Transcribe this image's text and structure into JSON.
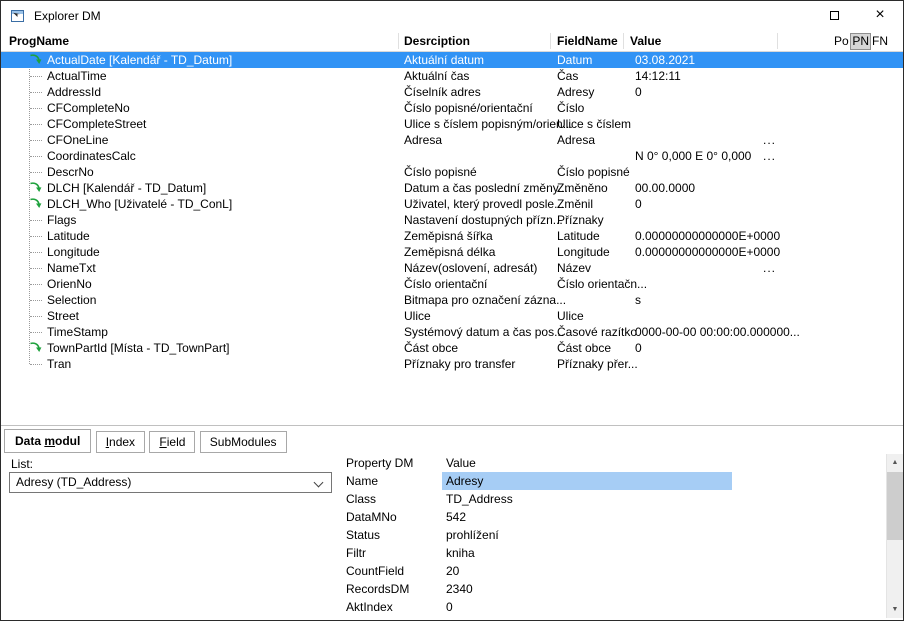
{
  "window": {
    "title": "Explorer DM",
    "close_glyph": "×"
  },
  "columns": {
    "progname": "ProgName",
    "description": "Desrciption",
    "fieldname": "FieldName",
    "value": "Value"
  },
  "filter_buttons": [
    {
      "label": "Po",
      "active": false
    },
    {
      "label": "PN",
      "active": true
    },
    {
      "label": "FN",
      "active": false
    }
  ],
  "tree": {
    "rows": [
      {
        "prog": "ActualDate [Kalendář - TD_Datum]",
        "desc": "Aktuální datum",
        "field": "Datum",
        "value": "03.08.2021",
        "icon": true,
        "selected": true
      },
      {
        "prog": "ActualTime",
        "desc": "Aktuální čas",
        "field": "Čas",
        "value": "14:12:11"
      },
      {
        "prog": "AddressId",
        "desc": "Číselník adres",
        "field": "Adresy",
        "value": "0"
      },
      {
        "prog": "CFCompleteNo",
        "desc": "Číslo popisné/orientační",
        "field": "Číslo",
        "value": ""
      },
      {
        "prog": "CFCompleteStreet",
        "desc": "Ulice s číslem popisným/orien...",
        "field": "Ulice s číslem",
        "value": ""
      },
      {
        "prog": "CFOneLine",
        "desc": "Adresa",
        "field": "Adresa",
        "value": "",
        "ellipsis": true
      },
      {
        "prog": "CoordinatesCalc",
        "desc": "",
        "field": "",
        "value": "N 0° 0,000 E 0° 0,000",
        "ellipsis": true
      },
      {
        "prog": "DescrNo",
        "desc": "Číslo popisné",
        "field": "Číslo popisné",
        "value": ""
      },
      {
        "prog": "DLCH [Kalendář - TD_Datum]",
        "desc": "Datum a čas poslední změny...",
        "field": "Změněno",
        "value": "00.00.0000",
        "icon": true
      },
      {
        "prog": "DLCH_Who [Uživatelé - TD_ConL]",
        "desc": "Uživatel, který provedl posle...",
        "field": "Změnil",
        "value": "0",
        "icon": true
      },
      {
        "prog": "Flags",
        "desc": "Nastavení dostupných přízn...",
        "field": "Příznaky",
        "value": ""
      },
      {
        "prog": "Latitude",
        "desc": "Zeměpisná šířka",
        "field": "Latitude",
        "value": "0.00000000000000E+0000"
      },
      {
        "prog": "Longitude",
        "desc": "Zeměpisná délka",
        "field": "Longitude",
        "value": "0.00000000000000E+0000"
      },
      {
        "prog": "NameTxt",
        "desc": "Název(oslovení, adresát)",
        "field": "Název",
        "value": "",
        "ellipsis": true
      },
      {
        "prog": "OrienNo",
        "desc": "Číslo orientační",
        "field": "Číslo orientačn...",
        "value": ""
      },
      {
        "prog": "Selection",
        "desc": "Bitmapa pro označení zázna...",
        "field": "",
        "value": "s"
      },
      {
        "prog": "Street",
        "desc": "Ulice",
        "field": "Ulice",
        "value": ""
      },
      {
        "prog": "TimeStamp",
        "desc": "Systémový datum a čas pos...",
        "field": "Časové razítko",
        "value": "0000-00-00 00:00:00.000000..."
      },
      {
        "prog": "TownPartId [Místa - TD_TownPart]",
        "desc": "Část obce",
        "field": "Část obce",
        "value": "0",
        "icon": true
      },
      {
        "prog": "Tran",
        "desc": "Příznaky pro transfer",
        "field": "Příznaky přer...",
        "value": ""
      }
    ]
  },
  "tabs": [
    {
      "pre": "Data ",
      "accel": "m",
      "post": "odul",
      "active": true
    },
    {
      "pre": "",
      "accel": "I",
      "post": "ndex",
      "active": false
    },
    {
      "pre": "",
      "accel": "F",
      "post": "ield",
      "active": false
    },
    {
      "pre": "SubModules",
      "accel": "",
      "post": "",
      "active": false
    }
  ],
  "list_panel": {
    "label": "List:",
    "selected": "Adresy (TD_Address)"
  },
  "property_grid": {
    "header": {
      "name": "Property DM",
      "value": "Value"
    },
    "rows": [
      {
        "name": "Name",
        "value": "Adresy",
        "highlight": true
      },
      {
        "name": "Class",
        "value": "TD_Address"
      },
      {
        "name": "DataMNo",
        "value": "542"
      },
      {
        "name": "Status",
        "value": "prohlížení"
      },
      {
        "name": "Filtr",
        "value": "kniha"
      },
      {
        "name": "CountField",
        "value": "20"
      },
      {
        "name": "RecordsDM",
        "value": "2340"
      },
      {
        "name": "AktIndex",
        "value": "0"
      }
    ]
  },
  "scrollbar": {
    "up": "▲",
    "down": "▼"
  },
  "colors": {
    "selection": "#3193f5",
    "selection_text": "#ffffff",
    "cell_highlight": "#a6cdf5",
    "icon_green": "#1fa23d"
  }
}
